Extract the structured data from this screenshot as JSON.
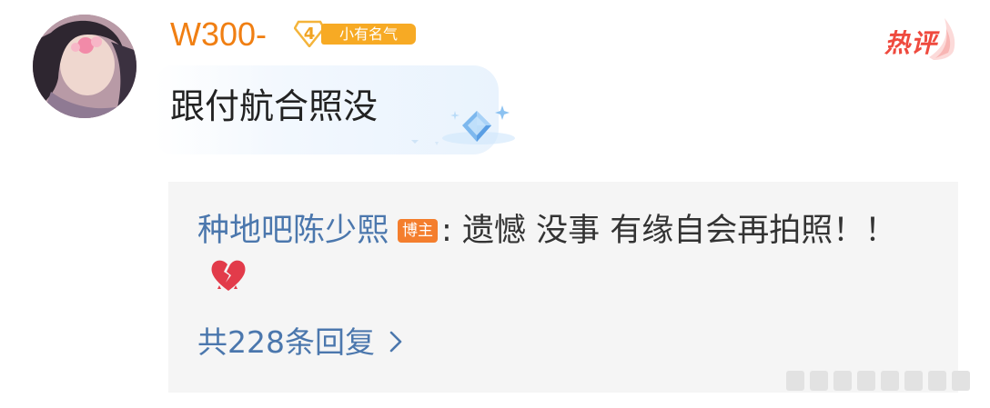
{
  "comment": {
    "username": "W300-",
    "level": "4",
    "badge_label": "小有名气",
    "hot_tag": "热评",
    "text": "跟付航合照没",
    "icons": {
      "avatar": "user-avatar",
      "hot": "hot-comment-tag",
      "decoration": "diamond-sparkle-icon"
    }
  },
  "reply": {
    "author": "种地吧陈少熙",
    "author_tag": "博主",
    "separator": ":",
    "text": "遗憾 没事 有缘自会再拍照！！",
    "emoji": "broken-heart-icon",
    "count_label": "共228条回复"
  },
  "colors": {
    "username": "#f07f13",
    "badge": "#f7aa24",
    "hot": "#ef4a3e",
    "link": "#4b77ad",
    "author_tag": "#f47e2d",
    "reply_bg": "#f5f5f5"
  }
}
